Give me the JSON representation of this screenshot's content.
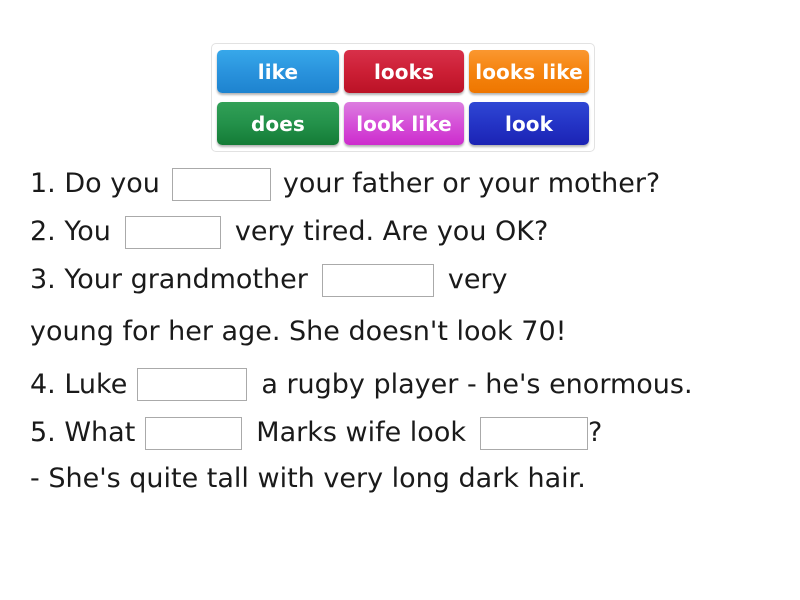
{
  "word_bank": {
    "rows": [
      [
        {
          "label": "like",
          "color": "#2a93dd"
        },
        {
          "label": "looks",
          "color": "#cc1f35"
        },
        {
          "label": "looks like",
          "color": "#f5840f"
        }
      ],
      [
        {
          "label": "does",
          "color": "#23914a"
        },
        {
          "label": "look like",
          "color": "#d551d8"
        },
        {
          "label": "look",
          "color": "#2434c6"
        }
      ]
    ]
  },
  "sentences": {
    "line1": {
      "before": "1. Do you",
      "after": "your father or your mother?"
    },
    "line2": {
      "before": "2. You",
      "after": "very tired. Are you OK?"
    },
    "line3": {
      "before": "3. Your grandmother",
      "after": "very"
    },
    "line3_wrap": {
      "text": "young for her age. She doesn't look 70!"
    },
    "line4": {
      "before": "4. Luke",
      "after": "a rugby player - he's enormous."
    },
    "line5": {
      "before": "5. What",
      "middle": "Marks wife look",
      "after": "?"
    },
    "line6": {
      "text": "- She's quite tall with very long dark hair."
    }
  }
}
